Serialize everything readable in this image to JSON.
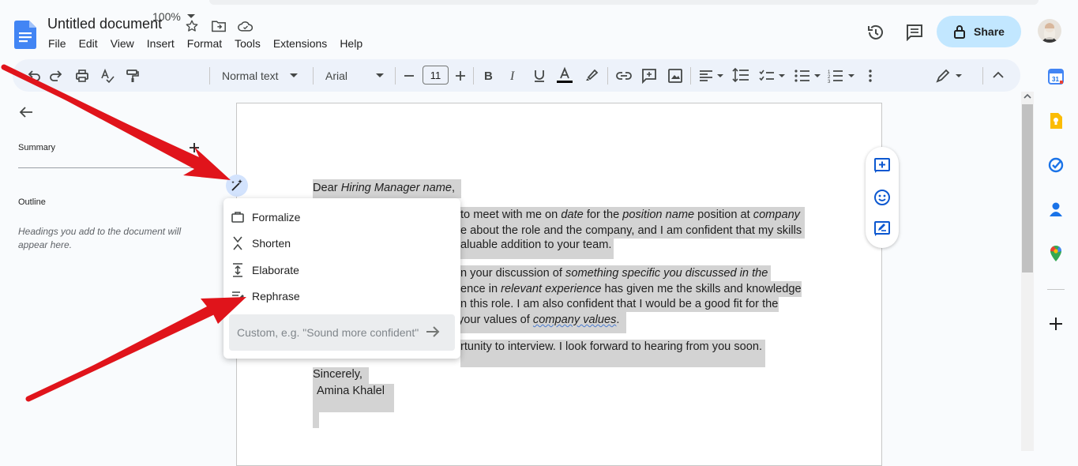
{
  "app": {
    "title": "Untitled document",
    "menu": [
      "File",
      "Edit",
      "View",
      "Insert",
      "Format",
      "Tools",
      "Extensions",
      "Help"
    ],
    "share_label": "Share"
  },
  "toolbar": {
    "zoom": "100%",
    "style": "Normal text",
    "font": "Arial",
    "font_size": "11"
  },
  "sidebar": {
    "summary_label": "Summary",
    "outline_label": "Outline",
    "outline_hint": "Headings you add to the document will appear here."
  },
  "document": {
    "greeting_plain": "Dear ",
    "greeting_italic": "Hiring Manager name",
    "greeting_end": ",",
    "p1_line1_a": "to meet with me on ",
    "p1_line1_b": "date",
    "p1_line1_c": " for the ",
    "p1_line1_d": "position name",
    "p1_line1_e": " position at ",
    "p1_line1_f": "company",
    "p1_line2": "e about the role and the company, and I am confident that my skills",
    "p1_line3": "aluable addition to your team.",
    "p2_line1_a": "n your discussion of ",
    "p2_line1_b": "something specific you discussed in the",
    "p2_line2_a": "ence in ",
    "p2_line2_b": "relevant experience",
    "p2_line2_c": " has given me the skills and knowledge",
    "p2_line3": "n this role. I am also confident that I would be a good fit for the",
    "p2_line4_a": "your values of ",
    "p2_line4_b": "company values",
    "p2_line4_c": ".",
    "p3": "rtunity to interview. I look forward to hearing from you soon.",
    "closing": "Sincerely,",
    "signature": "Amina Khalel"
  },
  "popup": {
    "items": [
      "Formalize",
      "Shorten",
      "Elaborate",
      "Rephrase"
    ],
    "custom_placeholder": "Custom, e.g. \"Sound more confident\""
  },
  "colors": {
    "accent": "#0b57d0",
    "share_bg": "#c2e7ff",
    "arrow": "#e0141b",
    "highlight": "#d3d3d3"
  }
}
